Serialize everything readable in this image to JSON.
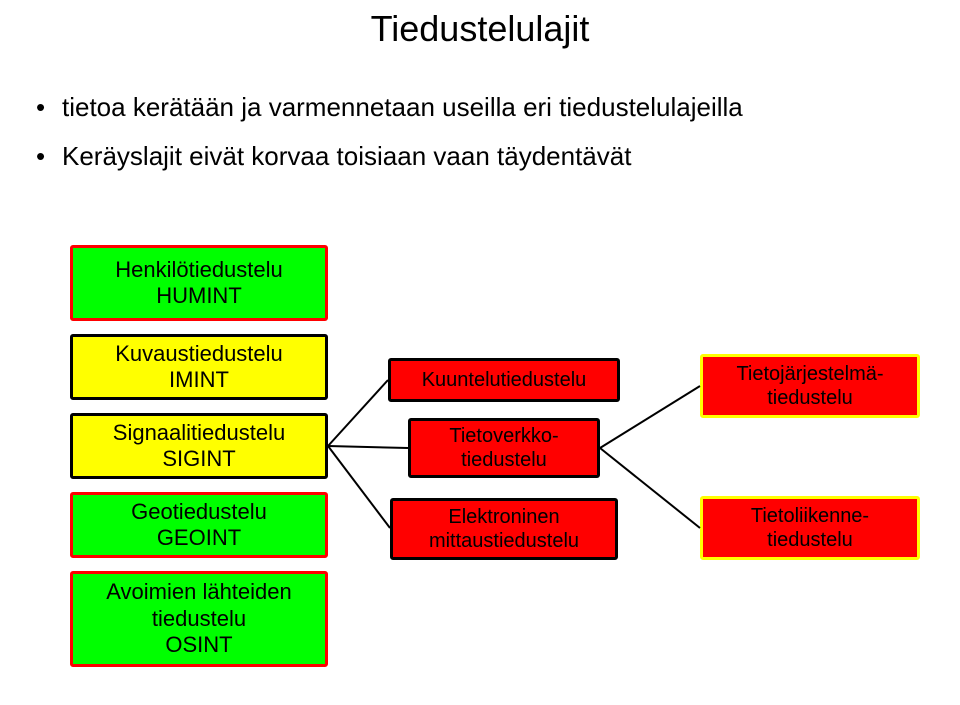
{
  "title": "Tiedustelulajit",
  "bullets": [
    "tietoa kerätään ja varmennetaan useilla eri tiedustelulajeilla",
    "Keräyslajit eivät korvaa toisiaan vaan täydentävät"
  ],
  "left_col": {
    "humint": {
      "line1": "Henkilötiedustelu",
      "line2": "HUMINT"
    },
    "imint": {
      "line1": "Kuvaustiedustelu",
      "line2": "IMINT"
    },
    "sigint": {
      "line1": "Signaalitiedustelu",
      "line2": "SIGINT"
    },
    "geoint": {
      "line1": "Geotiedustelu",
      "line2": "GEOINT"
    },
    "osint": {
      "line1": "Avoimien lähteiden",
      "line2": "tiedustelu",
      "line3": "OSINT"
    }
  },
  "mid_col": {
    "kuuntelu": "Kuuntelutiedustelu",
    "tietoverkko": {
      "line1": "Tietoverkko-",
      "line2": "tiedustelu"
    },
    "elektro": {
      "line1": "Elektroninen",
      "line2": "mittaustiedustelu"
    }
  },
  "right_col": {
    "tietojarj": {
      "line1": "Tietojärjestelmä-",
      "line2": "tiedustelu"
    },
    "tietoliik": {
      "line1": "Tietoliikenne-",
      "line2": "tiedustelu"
    }
  }
}
